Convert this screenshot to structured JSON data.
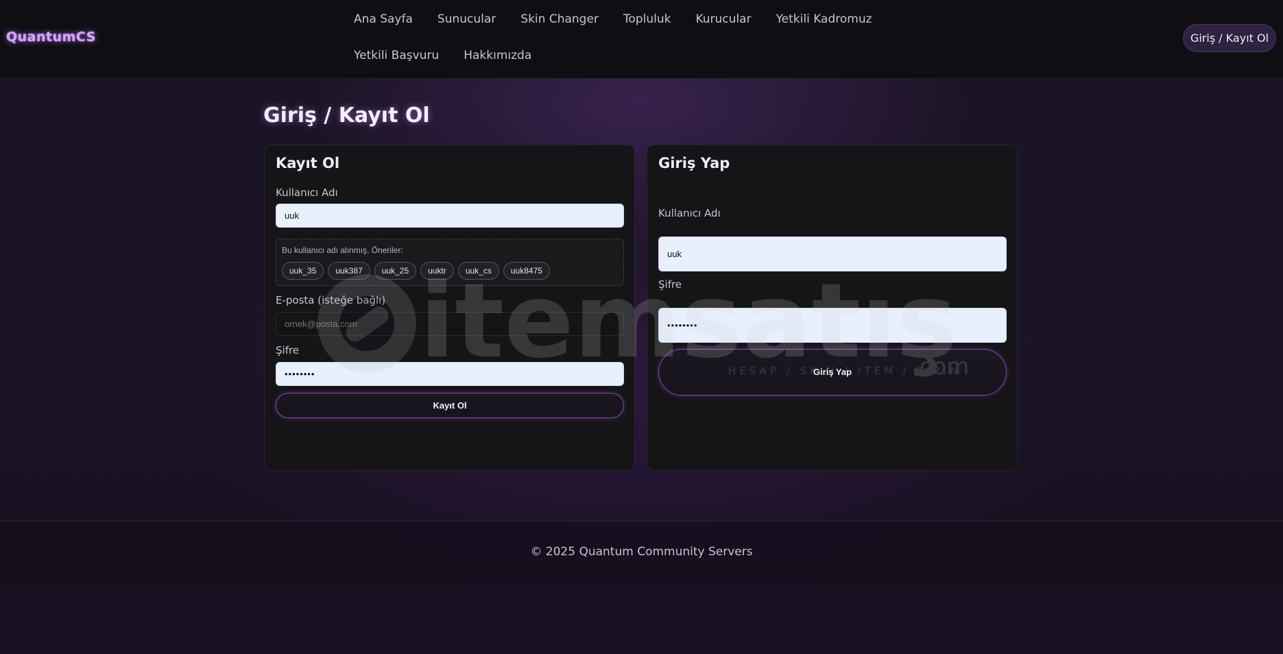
{
  "header": {
    "logo": "QuantumCS",
    "nav": [
      "Ana Sayfa",
      "Sunucular",
      "Skin Changer",
      "Topluluk",
      "Kurucular",
      "Yetkili Kadromuz",
      "Yetkili Başvuru",
      "Hakkımızda"
    ],
    "auth_button": "Giriş / Kayıt Ol"
  },
  "page_title": "Giriş / Kayıt Ol",
  "register": {
    "title": "Kayıt Ol",
    "username_label": "Kullanıcı Adı",
    "username_value": "uuk",
    "suggestion_title": "Bu kullanıcı adı alınmış. Öneriler:",
    "suggestions": [
      "uuk_35",
      "uuk387",
      "uuk_25",
      "uuktr",
      "uuk_cs",
      "uuk8475"
    ],
    "email_label": "E-posta (isteğe bağlı)",
    "email_placeholder": "ornek@posta.com",
    "password_label": "Şifre",
    "password_value": "••••••••",
    "submit": "Kayıt Ol"
  },
  "login": {
    "title": "Giriş Yap",
    "username_label": "Kullanıcı Adı",
    "username_value": "uuk",
    "password_label": "Şifre",
    "password_value": "••••••••",
    "submit": "Giriş Yap"
  },
  "footer": {
    "copyright": "© 2025 Quantum Community Servers"
  },
  "watermark": {
    "brand": "itemsatış",
    "tld": ".com",
    "tagline": "HESAP / SKIN / ITEM / E-PIN"
  }
}
